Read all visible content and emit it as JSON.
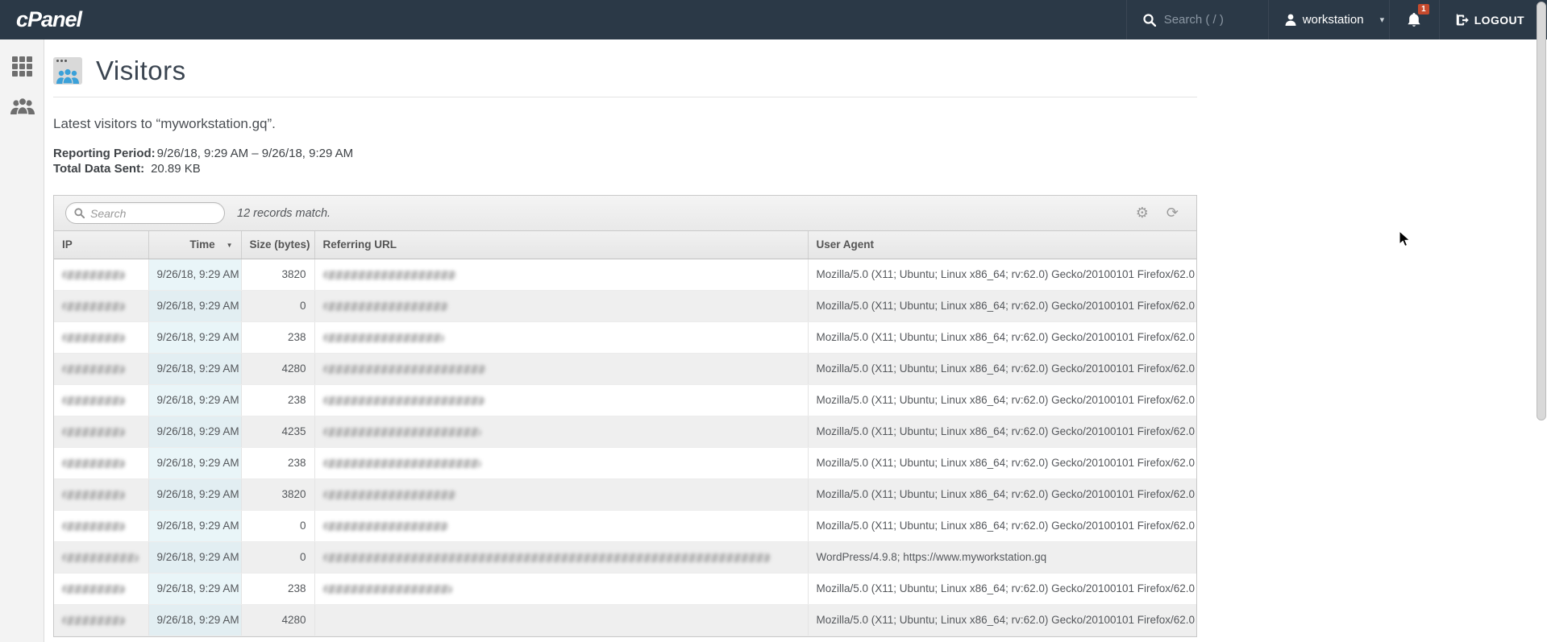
{
  "navbar": {
    "brand": "cPanel",
    "search_placeholder": "Search ( / )",
    "username": "workstation",
    "notification_count": "1",
    "logout_label": "LOGOUT"
  },
  "sidebar": {
    "items": [
      {
        "icon": "apps-grid-icon"
      },
      {
        "icon": "visitors-people-icon"
      }
    ]
  },
  "page": {
    "title": "Visitors",
    "subtitle": "Latest visitors to “myworkstation.gq”.",
    "reporting_period_label": "Reporting Period:",
    "reporting_period_value": "9/26/18, 9:29 AM  –  9/26/18, 9:29 AM",
    "total_data_label": "Total Data Sent:",
    "total_data_value": "20.89 KB"
  },
  "table": {
    "search_placeholder": "Search",
    "records_text": "12 records match.",
    "columns": [
      "IP",
      "Time",
      "Size (bytes)",
      "Referring URL",
      "User Agent"
    ],
    "sorted_column": "Time",
    "sort_direction": "desc",
    "user_agent_firefox": "Mozilla/5.0 (X11; Ubuntu; Linux x86_64; rv:62.0) Gecko/20100101 Firefox/62.0",
    "user_agent_wordpress": "WordPress/4.9.8; https://www.myworkstation.gq",
    "rows": [
      {
        "ip_redacted": true,
        "ip_w": 78,
        "time": "9/26/18, 9:29 AM",
        "size": "3820",
        "url_redacted": true,
        "url_w": 165,
        "ua": "firefox"
      },
      {
        "ip_redacted": true,
        "ip_w": 78,
        "time": "9/26/18, 9:29 AM",
        "size": "0",
        "url_redacted": true,
        "url_w": 155,
        "ua": "firefox"
      },
      {
        "ip_redacted": true,
        "ip_w": 78,
        "time": "9/26/18, 9:29 AM",
        "size": "238",
        "url_redacted": true,
        "url_w": 150,
        "ua": "firefox"
      },
      {
        "ip_redacted": true,
        "ip_w": 78,
        "time": "9/26/18, 9:29 AM",
        "size": "4280",
        "url_redacted": true,
        "url_w": 202,
        "ua": "firefox"
      },
      {
        "ip_redacted": true,
        "ip_w": 78,
        "time": "9/26/18, 9:29 AM",
        "size": "238",
        "url_redacted": true,
        "url_w": 200,
        "ua": "firefox"
      },
      {
        "ip_redacted": true,
        "ip_w": 78,
        "time": "9/26/18, 9:29 AM",
        "size": "4235",
        "url_redacted": true,
        "url_w": 196,
        "ua": "firefox"
      },
      {
        "ip_redacted": true,
        "ip_w": 78,
        "time": "9/26/18, 9:29 AM",
        "size": "238",
        "url_redacted": true,
        "url_w": 196,
        "ua": "firefox"
      },
      {
        "ip_redacted": true,
        "ip_w": 78,
        "time": "9/26/18, 9:29 AM",
        "size": "3820",
        "url_redacted": true,
        "url_w": 165,
        "ua": "firefox"
      },
      {
        "ip_redacted": true,
        "ip_w": 78,
        "time": "9/26/18, 9:29 AM",
        "size": "0",
        "url_redacted": true,
        "url_w": 155,
        "ua": "firefox"
      },
      {
        "ip_redacted": true,
        "ip_w": 95,
        "time": "9/26/18, 9:29 AM",
        "size": "0",
        "url_redacted": true,
        "url_w": 555,
        "ua": "wordpress"
      },
      {
        "ip_redacted": true,
        "ip_w": 78,
        "time": "9/26/18, 9:29 AM",
        "size": "238",
        "url_redacted": true,
        "url_w": 160,
        "ua": "firefox"
      },
      {
        "ip_redacted": true,
        "ip_w": 78,
        "time": "9/26/18, 9:29 AM",
        "size": "4280",
        "url_redacted": false,
        "url_w": 0,
        "ua": "firefox"
      }
    ]
  },
  "colors": {
    "navbar_bg": "#2b3947",
    "badge_bg": "#c64a2d",
    "icon_blue": "#3ba1d9",
    "sorted_cell_bg": "#e9f5f8",
    "stripe_bg": "#efefef"
  }
}
